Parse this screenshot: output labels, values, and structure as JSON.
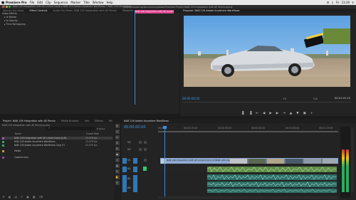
{
  "menubar": {
    "apple": "",
    "app_name": "Premiere Pro",
    "items": [
      "File",
      "Edit",
      "Clip",
      "Sequence",
      "Marker",
      "Title",
      "Window",
      "Help"
    ],
    "status": "23:29",
    "status_day": "Fri"
  },
  "window_title": "/Users/rickdoring/Documents/Adobe/Premiere Pro/8.0/NAB 126 Integration with AE Remix.prproj",
  "effect_panel": {
    "tabs": [
      "Source: (no clips)",
      "Effect Controls",
      "Audio Clip Mixer: NAB 126 Integration with AE Remix",
      "Metadata"
    ],
    "header": "Source • NAB 126 Integration with AE Linked Comp  ▸  NAB 126 Adobe Anywhere Workflows • NAB 126 Integration...",
    "clip_bar": "NAB 126 Integration with AE Linked",
    "rows": [
      {
        "label": "Video Effects"
      },
      {
        "label": "Motion"
      },
      {
        "label": "Opacity"
      },
      {
        "label": "Time Remapping"
      }
    ]
  },
  "program": {
    "tab": "Program: NAB 126 Adobe Anywhere Workflows",
    "timecode_left": "00:00:00:00",
    "timecode_right": "00:01:01:10",
    "fit": "Fit",
    "full": "Full"
  },
  "project": {
    "tabs": [
      "Project: NAB 126 Integration with AE Remix",
      "Media Browser",
      "Info",
      "Effects",
      "Ma"
    ],
    "subtitle": "NAB 126 Integration with AE Remix.prproj",
    "items_count": "8 Items",
    "search_placeholder": "",
    "col_name": "Name",
    "col_rate": "Frame Rate",
    "rows": [
      {
        "name": "NAB 126 Integration with AE Linked Comp [Lift]",
        "rate": "23.976 fps",
        "color": "#9b59b6"
      },
      {
        "name": "NAB 126 Adobe Anywhere Workflows",
        "rate": "23.976 fps",
        "color": "#27ae60"
      },
      {
        "name": "NAB 126 Adobe Anywhere Workflows Copy 01",
        "rate": "23.976 fps",
        "color": "#27ae60"
      },
      {
        "name": "Media",
        "rate": "",
        "color": "#c0a030"
      },
      {
        "name": "Capture.mov",
        "rate": "",
        "color": "#8e44ad"
      }
    ]
  },
  "timeline": {
    "tab": "NAB 126 Adobe Anywhere Workflows",
    "timecode": "00:00:00:00",
    "ruler": [
      "00:00",
      "00:00:15:00",
      "00:00:30:00",
      "00:00:45:00",
      "00:01:00:00",
      "00:01:15:00"
    ],
    "tracks": [
      "V3",
      "V2",
      "V1",
      "A1",
      "A2",
      "A3"
    ],
    "v1_clip_label": "NAB 126 Integration with AE Linked Comp 01/NAB 126 Integration with AE Remix.aep"
  }
}
